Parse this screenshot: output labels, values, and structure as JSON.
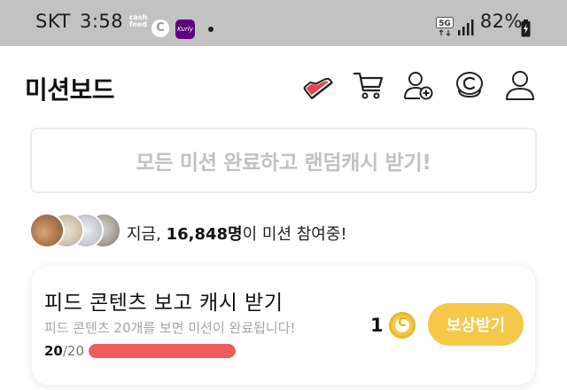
{
  "status_bar": {
    "carrier": "SKT",
    "time": "3:58",
    "cashfeed_line1": "cash",
    "cashfeed_line2": "feed",
    "c_app_label": "C",
    "kurly_label": "Kurly",
    "network": "5G",
    "battery": "82%"
  },
  "header": {
    "title": "미션보드",
    "icons": [
      "sneaker-icon",
      "cart-icon",
      "add-friend-icon",
      "coin-c-icon",
      "profile-icon"
    ]
  },
  "banner": {
    "label": "모든 미션 완료하고 랜덤캐시 받기!"
  },
  "participants": {
    "prefix": "지금, ",
    "count": "16,848명",
    "suffix": "이 미션 참여중!"
  },
  "mission": {
    "title": "피드 콘텐츠 보고 캐시 받기",
    "description": "피드 콘텐츠 20개를 보면 미션이 완료됩니다!",
    "progress_current": "20",
    "progress_total": "/20",
    "progress_fraction": 1.0,
    "reward_amount": "1",
    "coin_symbol": "C",
    "claim_label": "보상받기"
  },
  "colors": {
    "status_bar_bg": "#c2c2c2",
    "progress_fill": "#f05b5b",
    "claim_button": "#f6c84a",
    "coin": "#f4c842",
    "banner_text": "#c2c2c2"
  }
}
